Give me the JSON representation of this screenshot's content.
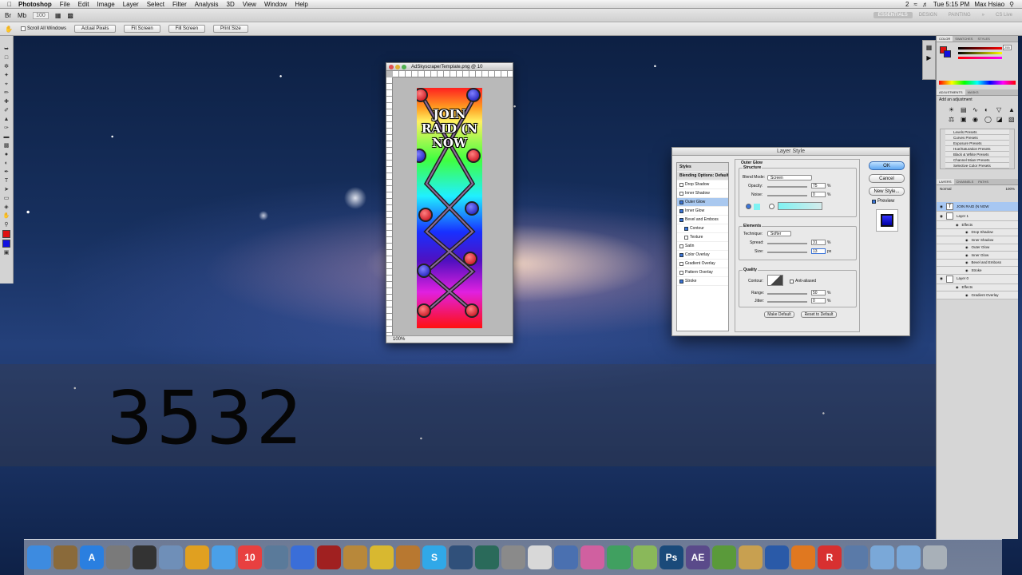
{
  "menubar": {
    "app": "Photoshop",
    "items": [
      "File",
      "Edit",
      "Image",
      "Layer",
      "Select",
      "Filter",
      "Analysis",
      "3D",
      "View",
      "Window",
      "Help"
    ],
    "clock": "Tue 5:15 PM",
    "user": "Max Hsiao",
    "badge": "2"
  },
  "appbar": {
    "zoom": "100",
    "workspaces": [
      "ESSENTIALS",
      "DESIGN",
      "PAINTING"
    ],
    "cs_live": "CS Live"
  },
  "optbar": {
    "scroll_all": "Scroll All Windows",
    "buttons": [
      "Actual Pixels",
      "Fit Screen",
      "Fill Screen",
      "Print Size"
    ]
  },
  "document": {
    "title": "AdSkyscraperTemplate.png @ 10",
    "heading_lines": [
      "JOIN",
      "RAID (N",
      "NOW"
    ],
    "zoom": "100%"
  },
  "dialog": {
    "title": "Layer Style",
    "styles_header": "Styles",
    "blending": "Blending Options: Default",
    "styles": [
      {
        "label": "Drop Shadow",
        "checked": false,
        "selected": false,
        "indent": false
      },
      {
        "label": "Inner Shadow",
        "checked": false,
        "selected": false,
        "indent": false
      },
      {
        "label": "Outer Glow",
        "checked": true,
        "selected": true,
        "indent": false
      },
      {
        "label": "Inner Glow",
        "checked": true,
        "selected": false,
        "indent": false
      },
      {
        "label": "Bevel and Emboss",
        "checked": true,
        "selected": false,
        "indent": false
      },
      {
        "label": "Contour",
        "checked": true,
        "selected": false,
        "indent": true
      },
      {
        "label": "Texture",
        "checked": false,
        "selected": false,
        "indent": true
      },
      {
        "label": "Satin",
        "checked": false,
        "selected": false,
        "indent": false
      },
      {
        "label": "Color Overlay",
        "checked": true,
        "selected": false,
        "indent": false
      },
      {
        "label": "Gradient Overlay",
        "checked": false,
        "selected": false,
        "indent": false
      },
      {
        "label": "Pattern Overlay",
        "checked": false,
        "selected": false,
        "indent": false
      },
      {
        "label": "Stroke",
        "checked": true,
        "selected": false,
        "indent": false
      }
    ],
    "panel_title": "Outer Glow",
    "structure": "Structure",
    "blend_mode_label": "Blend Mode:",
    "blend_mode": "Screen",
    "opacity_label": "Opacity:",
    "opacity": "75",
    "noise_label": "Noise:",
    "noise": "0",
    "percent": "%",
    "elements": "Elements",
    "technique_label": "Technique:",
    "technique": "Softer",
    "spread_label": "Spread:",
    "spread": "31",
    "size_label": "Size:",
    "size": "13",
    "px": "px",
    "quality": "Quality",
    "contour_label": "Contour:",
    "anti_aliased": "Anti-aliased",
    "range_label": "Range:",
    "range": "50",
    "jitter_label": "Jitter:",
    "jitter": "0",
    "make_default": "Make Default",
    "reset_default": "Reset to Default",
    "ok": "OK",
    "cancel": "Cancel",
    "new_style": "New Style...",
    "preview": "Preview",
    "glow_color": "#7ff2f2"
  },
  "panels": {
    "color_tabs": [
      "COLOR",
      "SWATCHES",
      "STYLES"
    ],
    "color_value": "255",
    "adj_tabs": [
      "ADJUSTMENTS",
      "MASKS"
    ],
    "add_adjustment": "Add an adjustment",
    "presets": [
      "Levels Presets",
      "Curves Presets",
      "Exposure Presets",
      "Hue/Saturation Presets",
      "Black & White Presets",
      "Channel Mixer Presets",
      "Selective Color Presets"
    ],
    "layer_tabs": [
      "LAYERS",
      "CHANNELS",
      "PATHS"
    ],
    "blend": "Normal",
    "opacity_value": "100%",
    "layers": [
      {
        "label": "JOIN RAID (N  NOW",
        "kind": "text",
        "selected": true
      },
      {
        "label": "Layer 1",
        "kind": "layer",
        "selected": false
      },
      {
        "label": "Effects",
        "kind": "effects",
        "selected": false
      },
      {
        "label": "Drop Shadow",
        "kind": "sub",
        "selected": false
      },
      {
        "label": "Inner Shadow",
        "kind": "sub",
        "selected": false
      },
      {
        "label": "Outer Glow",
        "kind": "sub",
        "selected": false
      },
      {
        "label": "Inner Glow",
        "kind": "sub",
        "selected": false
      },
      {
        "label": "Bevel and Emboss",
        "kind": "sub",
        "selected": false
      },
      {
        "label": "Stroke",
        "kind": "sub",
        "selected": false
      },
      {
        "label": "Layer 0",
        "kind": "layer",
        "selected": false
      },
      {
        "label": "Effects",
        "kind": "effects",
        "selected": false
      },
      {
        "label": "Gradient Overlay",
        "kind": "sub",
        "selected": false
      }
    ]
  },
  "overlay": {
    "counter": "3532"
  },
  "dock": {
    "calendar_day": "10",
    "apps": [
      {
        "name": "finder",
        "color": "#3d8be0",
        "label": ""
      },
      {
        "name": "app-2",
        "color": "#8a6a3a",
        "label": ""
      },
      {
        "name": "app-store",
        "color": "#2a7fe0",
        "label": "A"
      },
      {
        "name": "rocket",
        "color": "#7a7a7a",
        "label": ""
      },
      {
        "name": "dashboard",
        "color": "#333333",
        "label": ""
      },
      {
        "name": "preview",
        "color": "#6f8fb8",
        "label": ""
      },
      {
        "name": "chrome",
        "color": "#e0a020",
        "label": ""
      },
      {
        "name": "safari",
        "color": "#4aa0e8",
        "label": ""
      },
      {
        "name": "ical",
        "color": "#e84040",
        "label": "10"
      },
      {
        "name": "iphoto",
        "color": "#5a7a9a",
        "label": ""
      },
      {
        "name": "itunes",
        "color": "#3a6ed8",
        "label": ""
      },
      {
        "name": "photo-booth",
        "color": "#a02020",
        "label": ""
      },
      {
        "name": "image-capture",
        "color": "#b8883a",
        "label": ""
      },
      {
        "name": "imovie",
        "color": "#d8b830",
        "label": ""
      },
      {
        "name": "garageband",
        "color": "#b87830",
        "label": ""
      },
      {
        "name": "skype",
        "color": "#30a8e8",
        "label": "S"
      },
      {
        "name": "clapper",
        "color": "#30507a",
        "label": ""
      },
      {
        "name": "time-machine",
        "color": "#2a6a5a",
        "label": ""
      },
      {
        "name": "system-prefs",
        "color": "#8a8a8a",
        "label": ""
      },
      {
        "name": "app-20",
        "color": "#d8d8d8",
        "label": ""
      },
      {
        "name": "xcode",
        "color": "#4a70b0",
        "label": ""
      },
      {
        "name": "app-22",
        "color": "#d060a0",
        "label": ""
      },
      {
        "name": "final-cut",
        "color": "#40a060",
        "label": ""
      },
      {
        "name": "app-24",
        "color": "#8ab85a",
        "label": ""
      },
      {
        "name": "photoshop",
        "color": "#1a4a7a",
        "label": "Ps"
      },
      {
        "name": "after-effects",
        "color": "#5a4a8a",
        "label": "AE"
      },
      {
        "name": "minecraft",
        "color": "#5a9a3a",
        "label": ""
      },
      {
        "name": "app-28",
        "color": "#c8a050",
        "label": ""
      },
      {
        "name": "google-earth",
        "color": "#2a5aa8",
        "label": ""
      },
      {
        "name": "blender",
        "color": "#e07820",
        "label": ""
      },
      {
        "name": "roblox",
        "color": "#d83030",
        "label": "R"
      },
      {
        "name": "app-32",
        "color": "#5a7aa8",
        "label": ""
      },
      {
        "name": "applications-folder",
        "color": "#7aa8d8",
        "label": ""
      },
      {
        "name": "downloads-folder",
        "color": "#7aa8d8",
        "label": ""
      },
      {
        "name": "trash",
        "color": "#a8b0b8",
        "label": ""
      }
    ]
  }
}
